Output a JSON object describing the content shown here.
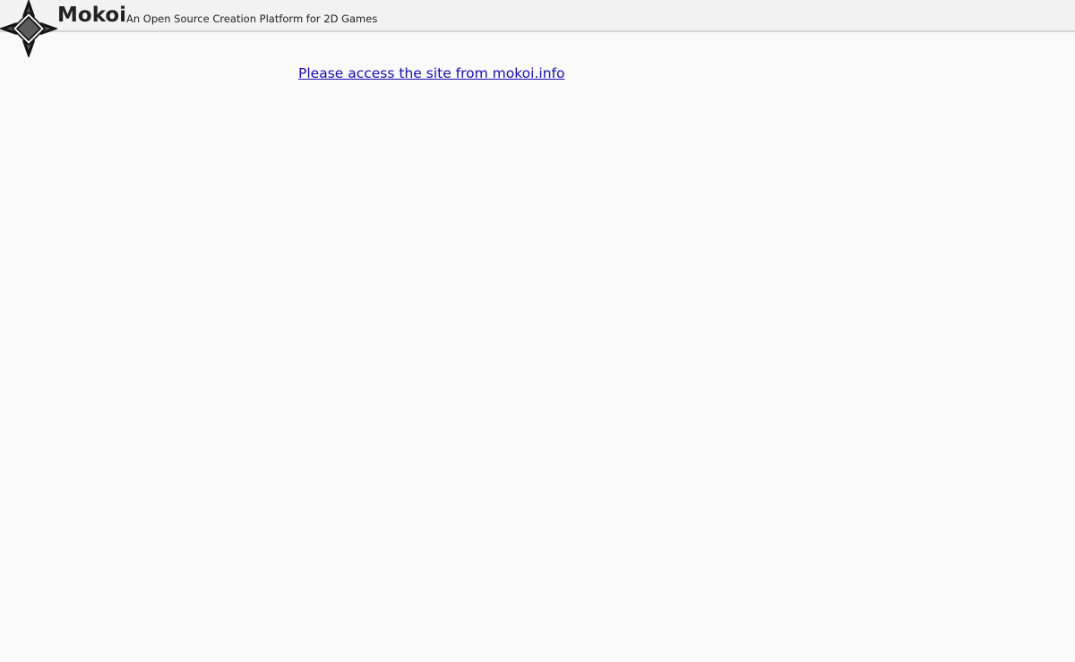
{
  "header": {
    "brand_name": "Mokoi",
    "tagline": "An Open Source Creation Platform for 2D Games",
    "logo_icon": "compass-star-icon"
  },
  "main": {
    "access_link_text": "Please access the site from mokoi.info"
  },
  "colors": {
    "page_background": "#fafafa",
    "header_background": "#f2f2f2",
    "header_border": "#d7d7d7",
    "link": "#1a0dab",
    "logo_fill": "#5c5c5c"
  }
}
